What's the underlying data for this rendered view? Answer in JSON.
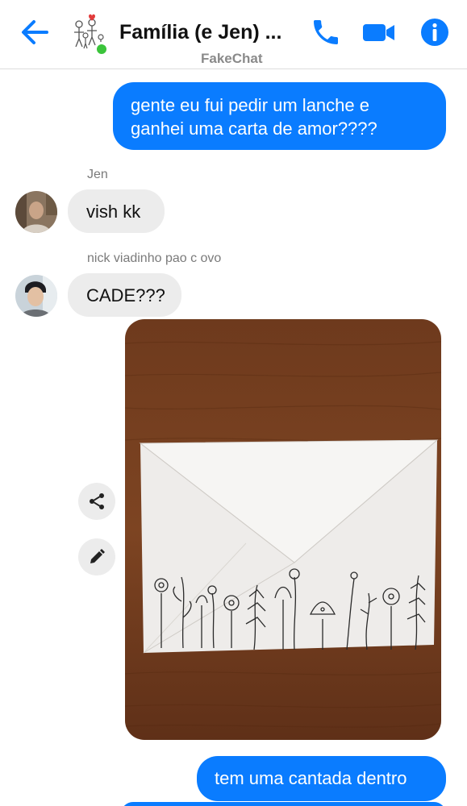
{
  "header": {
    "title": "Família (e Jen) ...",
    "subtitle": "FakeChat",
    "accent_color": "#0a7cff",
    "online_color": "#3bc43b",
    "icons": [
      "back-arrow-icon",
      "phone-icon",
      "video-camera-icon",
      "info-icon"
    ]
  },
  "messages": [
    {
      "type": "outgoing",
      "text_line1": "gente eu fui pedir um lanche e",
      "text_line2": "ganhei uma carta de amor????"
    },
    {
      "type": "incoming",
      "sender": "Jen",
      "text": "vish kk"
    },
    {
      "type": "incoming",
      "sender": "nick viadinho pao c ovo",
      "text": "CADE???"
    },
    {
      "type": "outgoing-image",
      "description_icon": "photo-envelope"
    },
    {
      "type": "outgoing",
      "text": "tem uma cantada dentro"
    }
  ],
  "actions": {
    "share_icon": "share-icon",
    "edit_icon": "pencil-icon"
  }
}
